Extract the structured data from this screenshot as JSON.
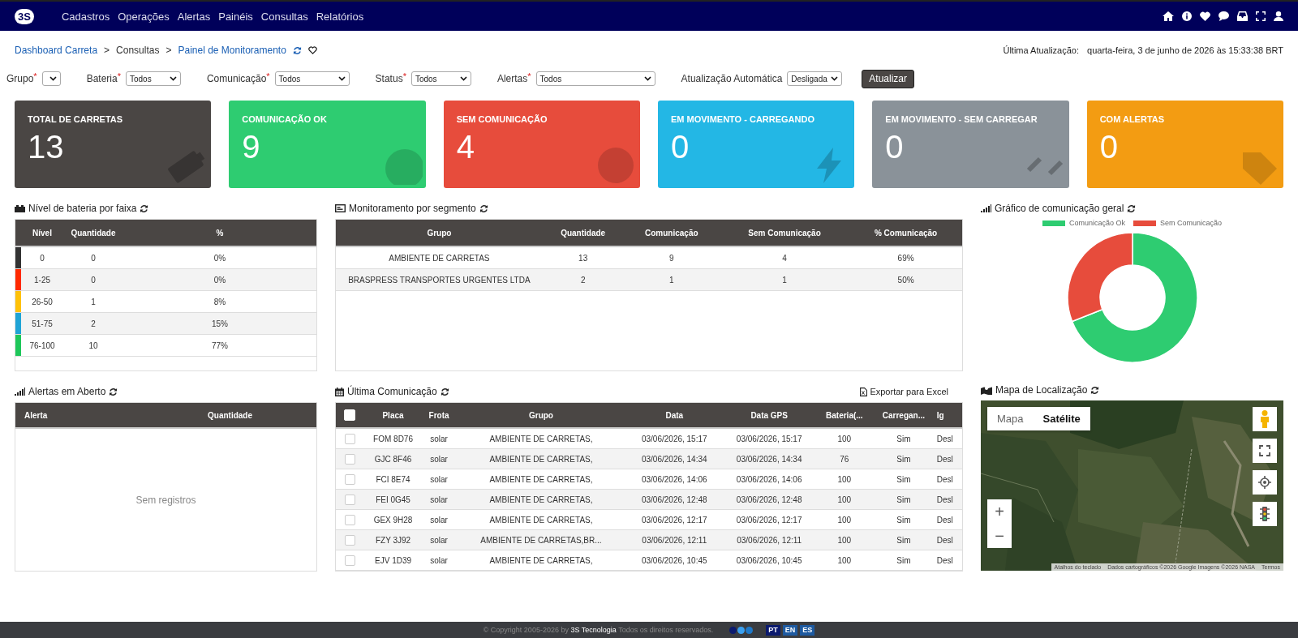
{
  "navbar": {
    "logo": "3S",
    "menu": [
      {
        "label": "Cadastros"
      },
      {
        "label": "Operações"
      },
      {
        "label": "Alertas"
      },
      {
        "label": "Painéis"
      },
      {
        "label": "Consultas"
      },
      {
        "label": "Relatórios"
      }
    ]
  },
  "breadcrumb": [
    {
      "label": "Dashboard Carreta",
      "link": true
    },
    {
      "separator": ">",
      "label": "Consultas",
      "link": false
    },
    {
      "separator": ">",
      "label": "Painel de Monitoramento",
      "link": true
    }
  ],
  "last_update": {
    "label": "Última Atualização:",
    "value": "quarta-feira, 3 de junho de 2026 às 15:33:38 BRT"
  },
  "filters": [
    {
      "label": "Grupo",
      "required_mark": "*"
    },
    {
      "label": "Bateria",
      "required_mark": "*",
      "value": "Todos"
    },
    {
      "label": "Comunicação",
      "required_mark": "*",
      "value": "Todos"
    },
    {
      "label": "Status",
      "required_mark": "*",
      "value": "Todos"
    },
    {
      "label": "Alertas",
      "required_mark": "*",
      "value": "Todos"
    },
    {
      "label": "Atualização Automática",
      "value": "Desligada"
    }
  ],
  "refresh_button": "Atualizar",
  "cards": [
    {
      "title": "TOTAL DE CARRETAS",
      "value": "13",
      "color": "#4a4644"
    },
    {
      "title": "COMUNICAÇÃO OK",
      "value": "9",
      "color": "#2ecc71"
    },
    {
      "title": "SEM COMUNICAÇÃO",
      "value": "4",
      "color": "#e74c3c"
    },
    {
      "title": "EM MOVIMENTO - CARREGANDO",
      "value": "0",
      "color": "#23b7e5"
    },
    {
      "title": "EM MOVIMENTO - SEM CARREGAR",
      "value": "0",
      "color": "#8a9299"
    },
    {
      "title": "COM ALERTAS",
      "value": "0",
      "color": "#f39c12"
    }
  ],
  "battery_panel": {
    "title": "Nível de bateria por faixa",
    "columns": [
      "Nível",
      "Quantidade",
      "%"
    ],
    "rows": [
      {
        "level": "0",
        "count": "0",
        "percent": "0%",
        "color": "#333333"
      },
      {
        "level": "1-25",
        "count": "0",
        "percent": "0%",
        "color": "#ff2a00"
      },
      {
        "level": "26-50",
        "count": "1",
        "percent": "8%",
        "color": "#ffc107"
      },
      {
        "level": "51-75",
        "count": "2",
        "percent": "15%",
        "color": "#1fa4d6"
      },
      {
        "level": "76-100",
        "count": "10",
        "percent": "77%",
        "color": "#1ec75a"
      }
    ]
  },
  "segment_panel": {
    "title": "Monitoramento por segmento",
    "columns": [
      "Grupo",
      "Quantidade",
      "Comunicação",
      "Sem Comunicação",
      "% Comunicação"
    ],
    "rows": [
      [
        "AMBIENTE DE CARRETAS",
        "13",
        "9",
        "4",
        "69%"
      ],
      [
        "BRASPRESS TRANSPORTES URGENTES LTDA",
        "2",
        "1",
        "1",
        "50%"
      ]
    ]
  },
  "chart_panel": {
    "title": "Gráfico de comunicação geral",
    "chart_data": {
      "type": "donut",
      "legend": "top",
      "categories": [
        "Comunicação Ok",
        "Sem Comunicação"
      ],
      "values": [
        69,
        31
      ]
    }
  },
  "alerts_panel": {
    "title": "Alertas em Aberto",
    "columns": [
      "Alerta",
      "Quantidade"
    ],
    "empty": "Sem registros"
  },
  "last_comm_panel": {
    "title": "Última Comunicação",
    "export": "Exportar para Excel",
    "header_checked": false,
    "columns": [
      "Placa",
      "Frota",
      "Grupo",
      "Data",
      "Data GPS",
      "Bateria(...",
      "Carregan...",
      "Ig"
    ],
    "rows": [
      {
        "checked": false,
        "cells": [
          "FOM 8D76",
          "solar",
          "AMBIENTE DE CARRETAS,",
          "03/06/2026, 15:17",
          "03/06/2026, 15:17",
          "100",
          "Sim",
          "Desl"
        ]
      },
      {
        "checked": false,
        "cells": [
          "GJC 8F46",
          "solar",
          "AMBIENTE DE CARRETAS,",
          "03/06/2026, 14:34",
          "03/06/2026, 14:34",
          "76",
          "Sim",
          "Desl"
        ]
      },
      {
        "checked": false,
        "cells": [
          "FCI 8E74",
          "solar",
          "AMBIENTE DE CARRETAS,",
          "03/06/2026, 14:06",
          "03/06/2026, 14:06",
          "100",
          "Sim",
          "Desl"
        ]
      },
      {
        "checked": false,
        "cells": [
          "FEI 0G45",
          "solar",
          "AMBIENTE DE CARRETAS,",
          "03/06/2026, 12:48",
          "03/06/2026, 12:48",
          "100",
          "Sim",
          "Desl"
        ]
      },
      {
        "checked": false,
        "cells": [
          "GEX 9H28",
          "solar",
          "AMBIENTE DE CARRETAS,",
          "03/06/2026, 12:17",
          "03/06/2026, 12:17",
          "100",
          "Sim",
          "Desl"
        ]
      },
      {
        "checked": false,
        "cells": [
          "FZY 3J92",
          "solar",
          "AMBIENTE DE CARRETAS,BR...",
          "03/06/2026, 12:11",
          "03/06/2026, 12:11",
          "100",
          "Sim",
          "Desl"
        ]
      },
      {
        "checked": false,
        "cells": [
          "EJV 1D39",
          "solar",
          "AMBIENTE DE CARRETAS,",
          "03/06/2026, 10:45",
          "03/06/2026, 10:45",
          "100",
          "Sim",
          "Desl"
        ]
      }
    ]
  },
  "map_panel": {
    "title": "Mapa de Localização",
    "map_types": [
      {
        "label": "Mapa",
        "selected": false
      },
      {
        "label": "Satélite",
        "selected": true
      }
    ],
    "zoom_in": "+",
    "zoom_out": "−",
    "attribution": [
      "Atalhos do teclado",
      "Dados cartográficos ©2026 Google Imagens ©2026 NASA",
      "Termos"
    ]
  },
  "footer": {
    "copyright": "© Copyright 2005-2026 by **3S Tecnologia** Todos os direitos reservados.",
    "languages": [
      {
        "label": "PT",
        "selected": true
      },
      {
        "label": "EN",
        "selected": false
      },
      {
        "label": "ES",
        "selected": false
      }
    ]
  }
}
